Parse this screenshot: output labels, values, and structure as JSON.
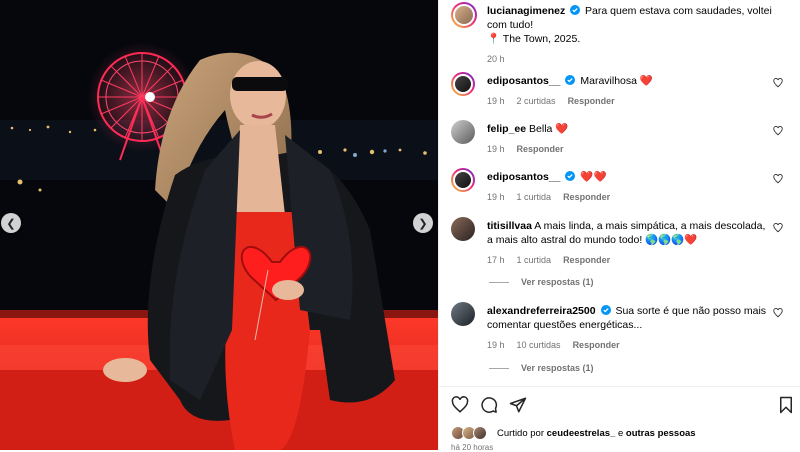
{
  "caption": {
    "username": "lucianagimenez",
    "text": "Para quem estava com saudades, voltei com tudo!",
    "location": "📍 The Town, 2025.",
    "time": "20 h"
  },
  "comments": [
    {
      "username": "ediposantos__",
      "verified": true,
      "text": "Maravilhosa",
      "emoji": "❤️",
      "time": "19 h",
      "likes": "2 curtidas",
      "reply": "Responder"
    },
    {
      "username": "felip_ee",
      "verified": false,
      "text": "Bella",
      "emoji": "❤️",
      "time": "19 h",
      "likes": "",
      "reply": "Responder"
    },
    {
      "username": "ediposantos__",
      "verified": true,
      "text": "",
      "emoji": "❤️❤️",
      "time": "19 h",
      "likes": "1 curtida",
      "reply": "Responder"
    },
    {
      "username": "titisillvaa",
      "verified": false,
      "text": "A mais linda, a mais simpática, a mais descolada, a mais alto astral do mundo todo!",
      "emoji": "🌎🌎🌎❤️",
      "time": "17 h",
      "likes": "1 curtida",
      "reply": "Responder"
    },
    {
      "username": "alexandreferreira2500",
      "verified": true,
      "text": "Sua sorte é que não posso mais comentar questões energéticas...",
      "emoji": "",
      "time": "19 h",
      "likes": "10 curtidas",
      "reply": "Responder"
    }
  ],
  "view_replies": [
    "Ver respostas (1)",
    "Ver respostas (1)"
  ],
  "likes": {
    "prefix": "Curtido por",
    "user": "ceudeestrelas_",
    "joiner": "e",
    "others": "outras pessoas"
  },
  "post_date": "há 20 horas",
  "icons": {
    "prev": "chevron-left-icon",
    "next": "chevron-right-icon",
    "like": "heart-icon",
    "comment": "comment-icon",
    "share": "send-icon",
    "save": "bookmark-icon"
  },
  "colors": {
    "verified": "#0095f6",
    "heart": "#ff3040",
    "meta": "#737373",
    "dress": "#e8281b"
  }
}
